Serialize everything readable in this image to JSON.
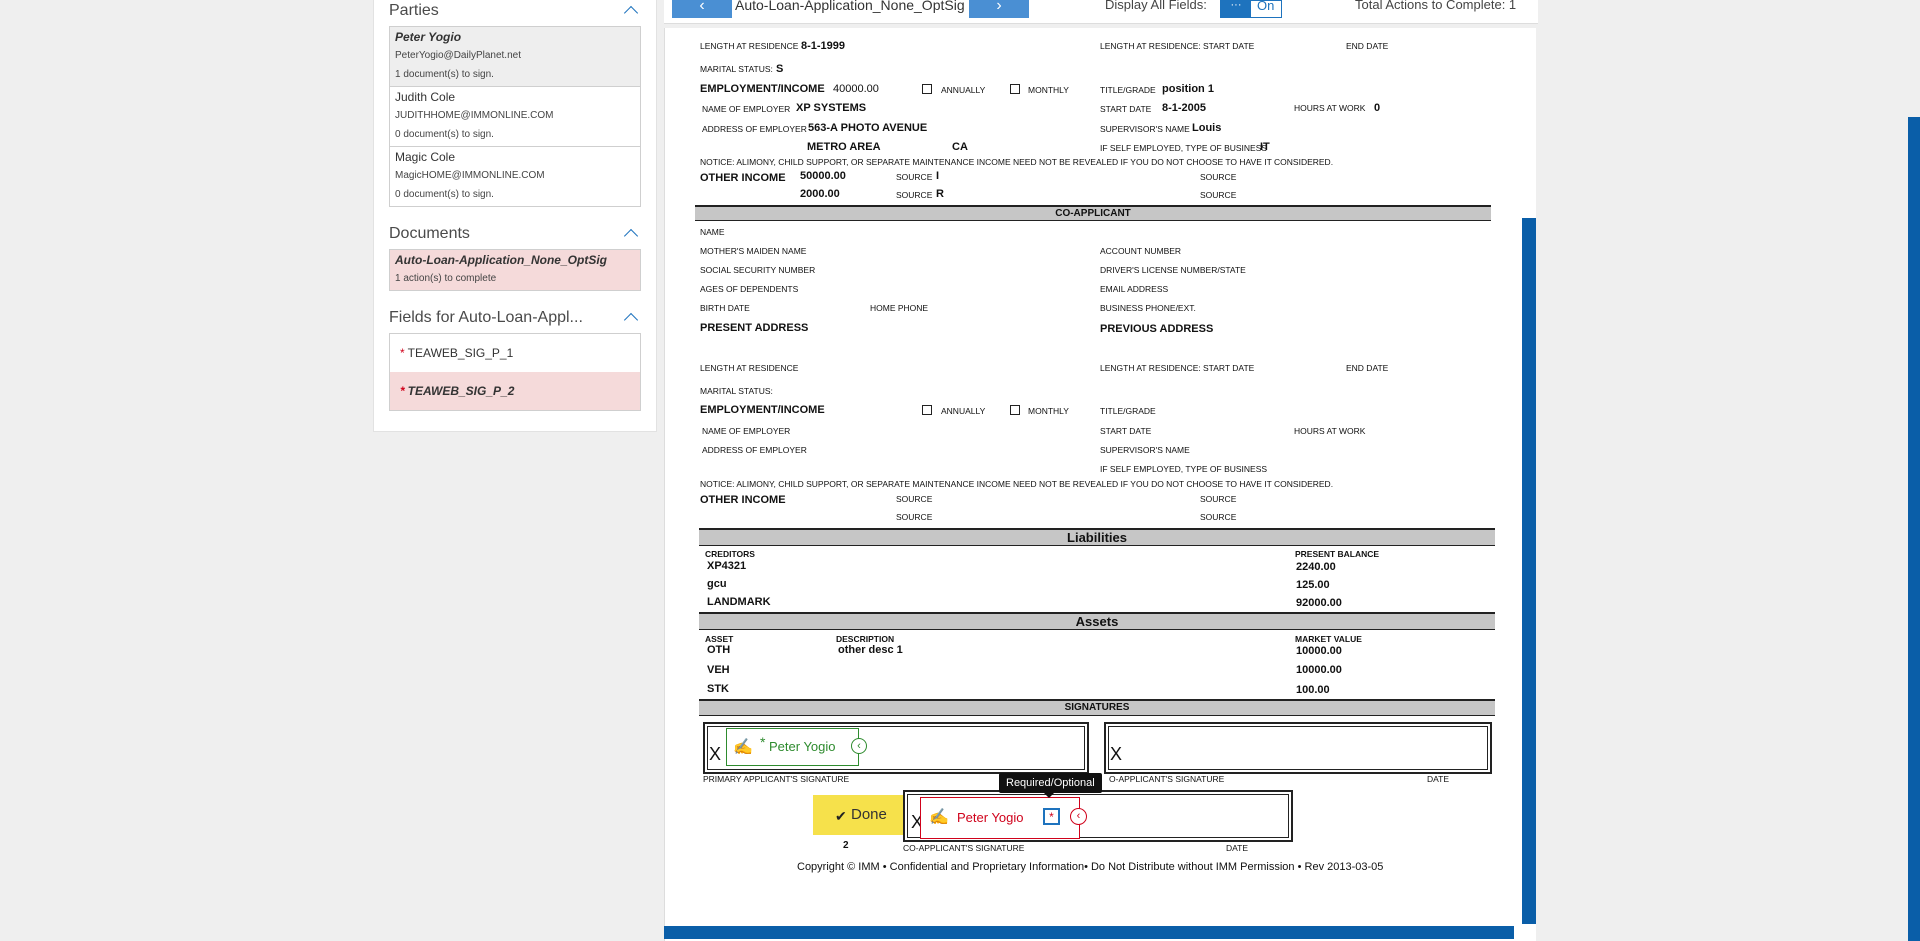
{
  "parties": {
    "title": "Parties",
    "items": [
      {
        "name": "Peter Yogio",
        "email": "PeterYogio@DailyPlanet.net",
        "status": "1 document(s) to sign."
      },
      {
        "name": "Judith Cole",
        "email": "JUDITHHOME@IMMONLINE.COM",
        "status": "0 document(s) to sign."
      },
      {
        "name": "Magic Cole",
        "email": "MagicHOME@IMMONLINE.COM",
        "status": "0 document(s) to sign."
      }
    ]
  },
  "documents": {
    "title": "Documents",
    "items": [
      {
        "name": "Auto-Loan-Application_None_OptSig",
        "status": "1 action(s) to complete"
      }
    ]
  },
  "fields": {
    "title": "Fields for Auto-Loan-Appl...",
    "items": [
      "TEAWEB_SIG_P_1",
      "TEAWEB_SIG_P_2"
    ],
    "req_mark": "*"
  },
  "toolbar": {
    "prev": "‹",
    "next": "›",
    "doc_title": "Auto-Loan-Application_None_OptSig",
    "display_label": "Display All Fields:",
    "toggle_knob": "···",
    "toggle_state": "On",
    "total_label": "Total Actions to Complete: 1"
  },
  "doc": {
    "app_length": "LENGTH AT RESIDENCE",
    "app_length_val": "8-1-1999",
    "app_length_r": "LENGTH AT RESIDENCE:",
    "start_date": "START DATE",
    "end_date": "END DATE",
    "marital": "MARITAL STATUS:",
    "marital_val": "S",
    "emp_income": "EMPLOYMENT/INCOME",
    "emp_income_val": "40000.00",
    "annually": "ANNUALLY",
    "monthly": "MONTHLY",
    "title_grade": "TITLE/GRADE",
    "title_grade_val": "position 1",
    "name_employer": "NAME OF EMPLOYER",
    "name_employer_val": "XP SYSTEMS",
    "start_date_val": "8-1-2005",
    "hours_at_work": "HOURS AT WORK",
    "hours_val": "0",
    "addr_employer": "ADDRESS OF EMPLOYER",
    "addr_employer_val": "563-A PHOTO AVENUE",
    "supervisor": "SUPERVISOR'S NAME",
    "supervisor_val": "Louis",
    "city": "METRO AREA",
    "state": "CA",
    "self_employed": "IF SELF EMPLOYED, TYPE OF BUSINESS",
    "self_employed_val": "IT",
    "notice": "NOTICE: ALIMONY, CHILD SUPPORT, OR SEPARATE MAINTENANCE INCOME NEED NOT BE REVEALED IF YOU DO NOT CHOOSE TO HAVE IT CONSIDERED.",
    "other_income": "OTHER INCOME",
    "other_income_1": "50000.00",
    "other_income_2": "2000.00",
    "source": "SOURCE",
    "source_1": "I",
    "source_2": "R",
    "co_applicant": "CO-APPLICANT",
    "name": "NAME",
    "maiden": "MOTHER'S MAIDEN NAME",
    "account": "ACCOUNT NUMBER",
    "ssn": "SOCIAL SECURITY NUMBER",
    "license": "DRIVER'S LICENSE NUMBER/STATE",
    "dependents": "AGES OF DEPENDENTS",
    "email": "EMAIL ADDRESS",
    "birth": "BIRTH DATE",
    "home_phone": "HOME PHONE",
    "biz_phone": "BUSINESS PHONE/EXT.",
    "present_addr": "PRESENT ADDRESS",
    "previous_addr": "PREVIOUS ADDRESS",
    "liabilities": "Liabilities",
    "creditors": "CREDITORS",
    "present_balance": "PRESENT BALANCE",
    "liab_rows": [
      {
        "name": "XP4321",
        "balance": "2240.00"
      },
      {
        "name": "gcu",
        "balance": "125.00"
      },
      {
        "name": "LANDMARK",
        "balance": "92000.00"
      }
    ],
    "assets": "Assets",
    "asset": "ASSET",
    "description": "DESCRIPTION",
    "market_value": "MARKET VALUE",
    "asset_rows": [
      {
        "asset": "OTH",
        "desc": "other desc 1",
        "value": "10000.00"
      },
      {
        "asset": "VEH",
        "desc": "",
        "value": "10000.00"
      },
      {
        "asset": "STK",
        "desc": "",
        "value": "100.00"
      }
    ],
    "signatures": "SIGNATURES",
    "x": "X",
    "primary_sig": "PRIMARY APPLICANT'S SIGNATURE",
    "co_sig_partial": "O-APPLICANT'S SIGNATURE",
    "co_sig": "CO-APPLICANT'S SIGNATURE",
    "date": "DATE",
    "page_num": "2",
    "copyright": "Copyright © IMM • Confidential and Proprietary Information• Do Not Distribute without IMM Permission • Rev 2013-03-05"
  },
  "sig_fields": {
    "green_name": "Peter Yogio",
    "green_star": "*",
    "red_name": "Peter Yogio",
    "red_star": "*",
    "tooltip": "Required/Optional",
    "done": "Done",
    "pen": "✍",
    "check": "✔",
    "circle_arrow": "‹"
  }
}
